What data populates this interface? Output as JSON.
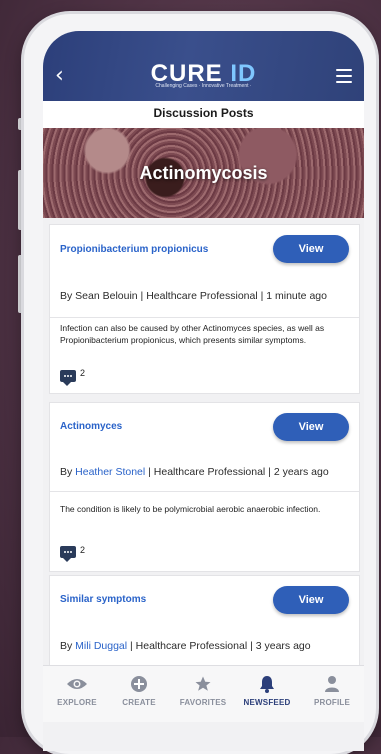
{
  "header": {
    "logo_cure": "CURE",
    "logo_id": "ID",
    "tagline": "Challenging Cases · Innovative Treatment ·"
  },
  "page_title": "Discussion Posts",
  "hero": {
    "title": "Actinomycosis"
  },
  "posts": [
    {
      "title": "Propionibacterium propionicus",
      "view_label": "View",
      "author": "By Sean Belouin",
      "role": "Healthcare Professional",
      "time": "1 minute ago",
      "body": "Infection can also be caused by other Actinomyces species, as well as Propionibacterium propionicus, which presents similar symptoms.",
      "comments": "2"
    },
    {
      "title": "Actinomyces",
      "view_label": "View",
      "author_prefix": "By ",
      "author": "Heather Stonel",
      "role": "Healthcare Professional",
      "time": "2 years ago",
      "body": "The condition is likely to be polymicrobial aerobic anaerobic infection.",
      "comments": "2"
    },
    {
      "title": "Similar symptoms",
      "view_label": "View",
      "author_prefix": "By ",
      "author": "Mili Duggal",
      "role": "Healthcare Professional",
      "time": "3 years ago"
    }
  ],
  "nav": [
    {
      "label": "EXPLORE",
      "icon": "eye-icon"
    },
    {
      "label": "CREATE",
      "icon": "plus-circle-icon"
    },
    {
      "label": "FAVORITES",
      "icon": "star-icon"
    },
    {
      "label": "NEWSFEED",
      "icon": "bell-icon",
      "active": true
    },
    {
      "label": "PROFILE",
      "icon": "user-icon"
    }
  ],
  "colors": {
    "brand": "#2c3f7a",
    "accent": "#2f5fb8",
    "link": "#2a63c9"
  }
}
